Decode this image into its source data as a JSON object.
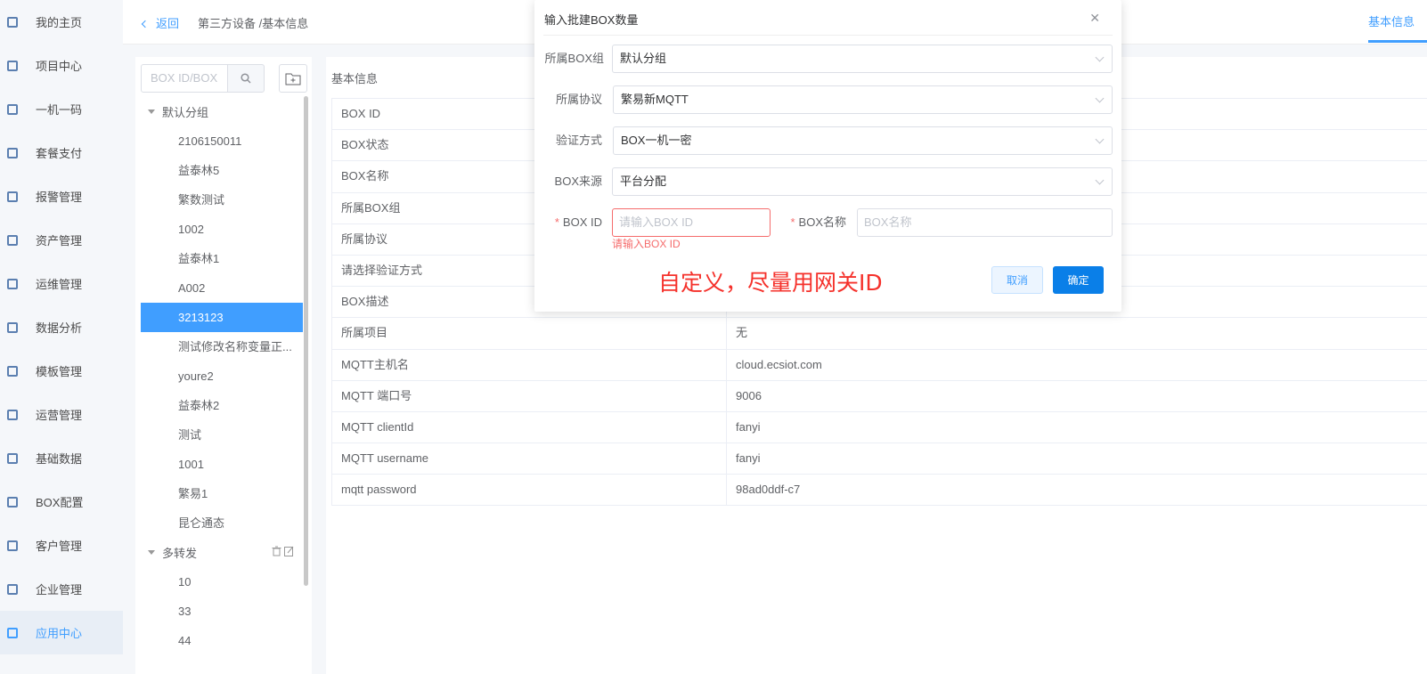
{
  "sidebar": {
    "items": [
      {
        "label": "我的主页",
        "icon": "home-icon"
      },
      {
        "label": "项目中心",
        "icon": "project-icon"
      },
      {
        "label": "一机一码",
        "icon": "qrcode-icon"
      },
      {
        "label": "套餐支付",
        "icon": "wechat-pay-icon"
      },
      {
        "label": "报警管理",
        "icon": "bell-icon"
      },
      {
        "label": "资产管理",
        "icon": "asset-icon"
      },
      {
        "label": "运维管理",
        "icon": "gear-icon"
      },
      {
        "label": "数据分析",
        "icon": "monitor-icon"
      },
      {
        "label": "模板管理",
        "icon": "template-icon"
      },
      {
        "label": "运营管理",
        "icon": "operation-icon"
      },
      {
        "label": "基础数据",
        "icon": "document-icon"
      },
      {
        "label": "BOX配置",
        "icon": "box-config-icon"
      },
      {
        "label": "客户管理",
        "icon": "users-icon"
      },
      {
        "label": "企业管理",
        "icon": "briefcase-icon"
      },
      {
        "label": "应用中心",
        "icon": "apps-icon"
      }
    ],
    "active_index": 14
  },
  "topbar": {
    "back_label": "返回",
    "breadcrumb": "第三方设备 /基本信息",
    "right_tab": "基本信息"
  },
  "tree": {
    "search_placeholder": "BOX ID/BOX",
    "groups": [
      {
        "label": "默认分组",
        "children": [
          "2106150011",
          "益泰林5",
          "繁数测试",
          "1002",
          "益泰林1",
          "A002",
          "3213123",
          "测试修改名称变量正...",
          "youre2",
          "益泰林2",
          "测试",
          "1001",
          "繁易1",
          "昆仑通态"
        ]
      },
      {
        "label": "多转发",
        "children": [
          "10",
          "33",
          "44"
        ]
      }
    ],
    "selected": "3213123"
  },
  "content": {
    "section_title": "基本信息",
    "rows": [
      {
        "key": "BOX ID",
        "value": ""
      },
      {
        "key": "BOX状态",
        "value": ""
      },
      {
        "key": "BOX名称",
        "value": ""
      },
      {
        "key": "所属BOX组",
        "value": ""
      },
      {
        "key": "所属协议",
        "value": ""
      },
      {
        "key": "请选择验证方式",
        "value": ""
      },
      {
        "key": "BOX描述",
        "value": ""
      },
      {
        "key": "所属项目",
        "value": "无"
      },
      {
        "key": "MQTT主机名",
        "value": "cloud.ecsiot.com"
      },
      {
        "key": "MQTT 端口号",
        "value": "9006"
      },
      {
        "key": "MQTT clientId",
        "value": "fanyi"
      },
      {
        "key": "MQTT username",
        "value": "fanyi"
      },
      {
        "key": "mqtt password",
        "value": "98ad0ddf-c7"
      }
    ]
  },
  "dialog": {
    "title": "输入批建BOX数量",
    "fields": {
      "box_group": {
        "label": "所属BOX组",
        "value": "默认分组"
      },
      "protocol": {
        "label": "所属协议",
        "value": "繁易新MQTT"
      },
      "auth_method": {
        "label": "验证方式",
        "value": "BOX一机一密"
      },
      "box_source": {
        "label": "BOX来源",
        "value": "平台分配"
      },
      "box_id": {
        "label": "BOX ID",
        "placeholder": "请输入BOX ID",
        "error": "请输入BOX ID"
      },
      "box_name": {
        "label": "BOX名称",
        "placeholder": "BOX名称"
      }
    },
    "required_mark": "*",
    "annotation": "自定义，尽量用网关ID",
    "cancel_label": "取消",
    "confirm_label": "确定"
  },
  "colors": {
    "accent": "#409eff",
    "error": "#f56c6c",
    "annotation": "#f5312b",
    "primary_button": "#0a7fe8"
  }
}
